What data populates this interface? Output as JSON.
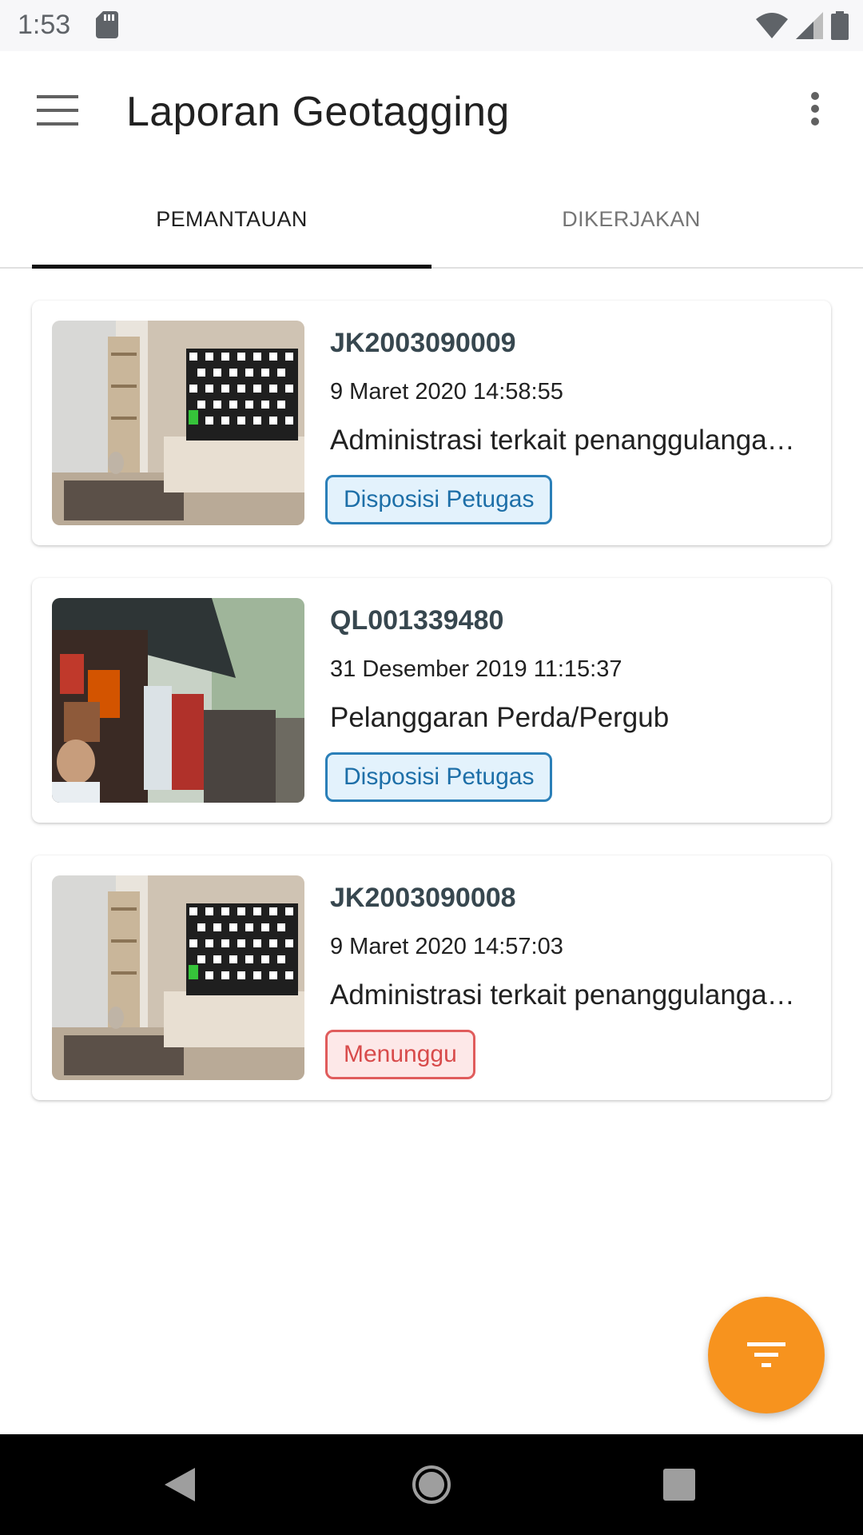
{
  "status_bar": {
    "time": "1:53",
    "icons": [
      "sd-card-icon",
      "wifi-icon",
      "cell-signal-icon",
      "battery-icon"
    ]
  },
  "app_bar": {
    "title": "Laporan Geotagging",
    "menu_icon": "hamburger-menu-icon",
    "overflow_icon": "more-vertical-icon"
  },
  "tabs": [
    {
      "label": "PEMANTAUAN",
      "selected": true
    },
    {
      "label": "DIKERJAKAN",
      "selected": false
    }
  ],
  "reports": [
    {
      "id": "JK2003090009",
      "date": "9 Maret 2020 14:58:55",
      "description": "Administrasi terkait penanggulangan…",
      "status": "Disposisi Petugas",
      "status_color": "#2a7fb8",
      "thumbnail": "room-with-tv-photo"
    },
    {
      "id": "QL001339480",
      "date": "31 Desember 2019 11:15:37",
      "description": "Pelanggaran Perda/Pergub",
      "status": "Disposisi Petugas",
      "status_color": "#2a7fb8",
      "thumbnail": "street-stall-photo"
    },
    {
      "id": "JK2003090008",
      "date": "9 Maret 2020 14:57:03",
      "description": "Administrasi terkait penanggulangan…",
      "status": "Menunggu",
      "status_color": "#e05c5c",
      "thumbnail": "room-with-tv-photo"
    }
  ],
  "fab": {
    "icon": "filter-icon",
    "color": "#f7931e"
  },
  "nav_bar": {
    "icons": [
      "back-icon",
      "home-icon",
      "recents-icon"
    ]
  }
}
